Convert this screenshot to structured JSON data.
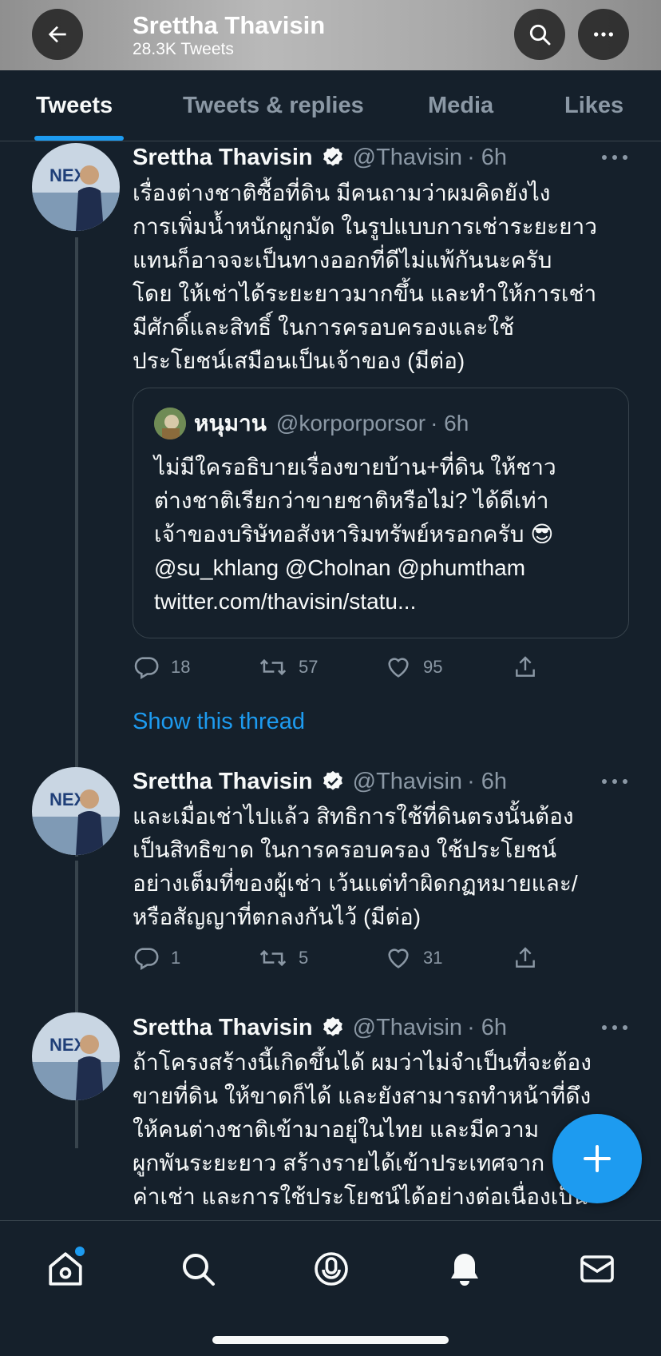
{
  "header": {
    "title": "Srettha Thavisin",
    "subtitle": "28.3K Tweets"
  },
  "tabs": [
    {
      "label": "Tweets",
      "active": true
    },
    {
      "label": "Tweets & replies",
      "active": false
    },
    {
      "label": "Media",
      "active": false
    },
    {
      "label": "Likes",
      "active": false
    }
  ],
  "tweets": [
    {
      "name": "Srettha Thavisin",
      "handle": "@Thavisin",
      "time": "· 6h",
      "text": "เรื่องต่างชาติซื้อที่ดิน มีคนถามว่าผมคิดยังไง\nการเพิ่มน้ำหนักผูกมัด ในรูปแบบการเช่าระยะยาว\nแทนก็อาจจะเป็นทางออกที่ดีไม่แพ้กันนะครับ\nโดย ให้เช่าได้ระยะยาวมากขึ้น และทำให้การเช่า\nมีศักดิ์และสิทธิ์ ในการครอบครองและใช้\nประโยชน์เสมือนเป็นเจ้าของ (มีต่อ)",
      "quote": {
        "name": "หนุมาน",
        "handle": "@korporporsor",
        "time": "· 6h",
        "text": "ไม่มีใครอธิบายเรื่องขายบ้าน+ที่ดิน ให้ชาว\nต่างชาติเรียกว่าขายชาติหรือไม่? ได้ดีเท่า\nเจ้าของบริษัทอสังหาริมทรัพย์หรอกครับ 😎\n@su_khlang @Cholnan @phumtham\ntwitter.com/thavisin/statu..."
      },
      "replies": "18",
      "retweets": "57",
      "likes": "95"
    },
    {
      "name": "Srettha Thavisin",
      "handle": "@Thavisin",
      "time": "· 6h",
      "text": "และเมื่อเช่าไปแล้ว สิทธิการใช้ที่ดินตรงนั้นต้อง\nเป็นสิทธิขาด ในการครอบครอง ใช้ประโยชน์\nอย่างเต็มที่ของผู้เช่า เว้นแต่ทำผิดกฏหมายและ/\nหรือสัญญาที่ตกลงกันไว้ (มีต่อ)",
      "replies": "1",
      "retweets": "5",
      "likes": "31"
    },
    {
      "name": "Srettha Thavisin",
      "handle": "@Thavisin",
      "time": "· 6h",
      "text": "ถ้าโครงสร้างนี้เกิดขึ้นได้ ผมว่าไม่จำเป็นที่จะต้อง\nขายที่ดิน ให้ขาดก็ได้ และยังสามารถทำหน้าที่ดึง\nให้คนต่างชาติเข้ามาอยู่ในไทย และมีความ\nผูกพันระยะยาว สร้างรายได้เข้าประเทศจาก\nค่าเช่า และการใช้ประโยชน์ได้อย่างต่อเนื่องเป็น"
    }
  ],
  "show_thread": "Show this thread",
  "colors": {
    "background": "#15202b",
    "accent": "#1d9bf0",
    "secondary_text": "#8b98a5",
    "border": "#38444d"
  }
}
